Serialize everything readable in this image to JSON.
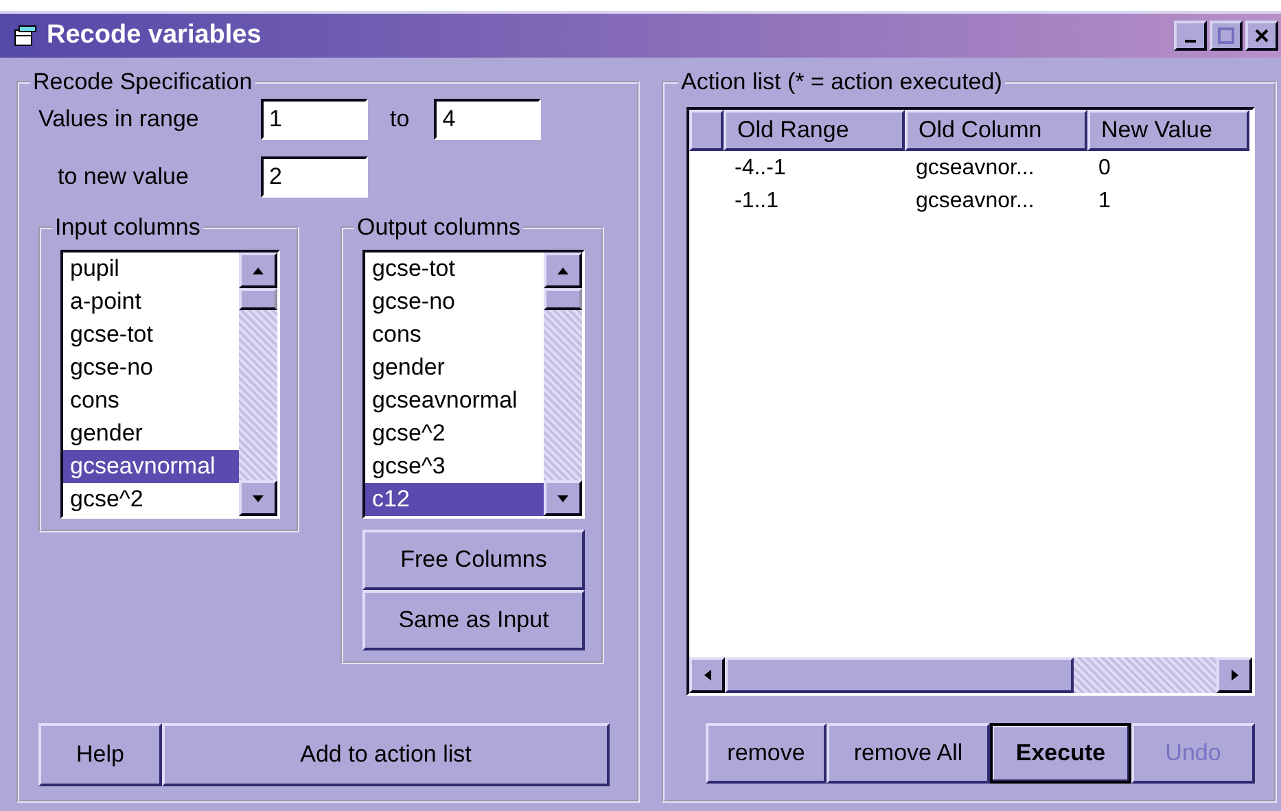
{
  "window": {
    "title": "Recode variables",
    "controls": [
      {
        "kind": "minimize",
        "disabled": false
      },
      {
        "kind": "maximize",
        "disabled": true
      },
      {
        "kind": "close",
        "disabled": false
      }
    ]
  },
  "spec": {
    "title": "Recode Specification",
    "range_label": "Values in range",
    "range_from": "1",
    "to_label": "to",
    "range_to": "4",
    "new_label": "to new value",
    "new_value": "2"
  },
  "input_columns": {
    "title": "Input columns",
    "items": [
      {
        "label": "pupil",
        "selected": false
      },
      {
        "label": "a-point",
        "selected": false
      },
      {
        "label": "gcse-tot",
        "selected": false
      },
      {
        "label": "gcse-no",
        "selected": false
      },
      {
        "label": "cons",
        "selected": false
      },
      {
        "label": "gender",
        "selected": false
      },
      {
        "label": "gcseavnormal",
        "selected": true
      },
      {
        "label": "gcse^2",
        "selected": false
      }
    ]
  },
  "output_columns": {
    "title": "Output columns",
    "items": [
      {
        "label": "gcse-tot",
        "selected": false
      },
      {
        "label": "gcse-no",
        "selected": false
      },
      {
        "label": "cons",
        "selected": false
      },
      {
        "label": "gender",
        "selected": false
      },
      {
        "label": "gcseavnormal",
        "selected": false
      },
      {
        "label": "gcse^2",
        "selected": false
      },
      {
        "label": "gcse^3",
        "selected": false
      },
      {
        "label": "c12",
        "selected": true
      }
    ],
    "buttons": [
      "Free Columns",
      "Same as Input"
    ]
  },
  "left_buttons": [
    "Help",
    "Add to action list"
  ],
  "action_list": {
    "title": "Action list (* = action executed)",
    "columns": [
      "Old Range",
      "Old Column",
      "New Value"
    ],
    "rows": [
      [
        "-4..-1",
        "gcseavnor...",
        "0"
      ],
      [
        "-1..1",
        "gcseavnor...",
        "1"
      ]
    ]
  },
  "action_buttons": [
    {
      "label": "remove",
      "default": false,
      "disabled": false
    },
    {
      "label": "remove All",
      "default": false,
      "disabled": false
    },
    {
      "label": "Execute",
      "default": true,
      "disabled": false
    },
    {
      "label": "Undo",
      "default": false,
      "disabled": true
    }
  ]
}
